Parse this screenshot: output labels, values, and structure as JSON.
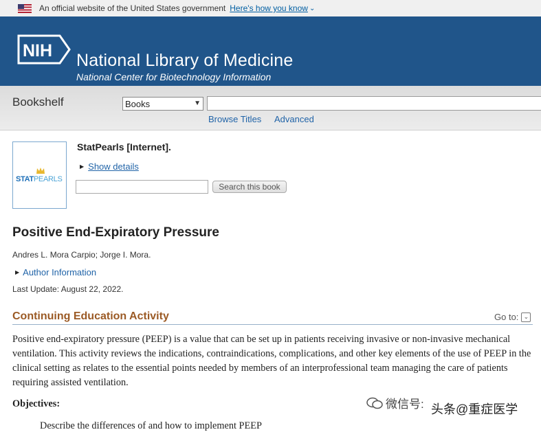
{
  "gov_banner": {
    "text": "An official website of the United States government",
    "link": "Here's how you know",
    "chevron": "⌄"
  },
  "header": {
    "logo": "NIH",
    "title": "National Library of Medicine",
    "subtitle": "National Center for Biotechnology Information",
    "bg_color": "#20558a"
  },
  "search_bar": {
    "section": "Bookshelf",
    "database_selected": "Books",
    "term_value": "",
    "links": [
      "Browse Titles",
      "Advanced"
    ]
  },
  "book": {
    "cover_logo_main": "STAT",
    "cover_logo_accent": "PEARLS",
    "title": "StatPearls [Internet].",
    "show_details": "Show details",
    "search_value": "",
    "search_button": "Search this book"
  },
  "article": {
    "title": "Positive End-Expiratory Pressure",
    "authors": "Andres L. Mora Carpio; Jorge I. Mora.",
    "author_info": "Author Information",
    "last_update": "Last Update: August 22, 2022."
  },
  "section": {
    "title": "Continuing Education Activity",
    "goto": "Go to:",
    "paragraph": "Positive end-expiratory pressure (PEEP) is a value that can be set up in patients receiving invasive or non-invasive mechanical ventilation. This activity reviews the indications, contraindications, complications, and other key elements of the use of PEEP in the clinical setting as relates to the essential points needed by members of an interprofessional team managing the care of patients requiring assisted ventilation.",
    "objectives_heading": "Objectives:",
    "first_objective_partial": "Describe the differences of and how to implement PEEP"
  },
  "watermark": {
    "wechat": "微信号:",
    "toutiao": "头条@重症医学"
  }
}
